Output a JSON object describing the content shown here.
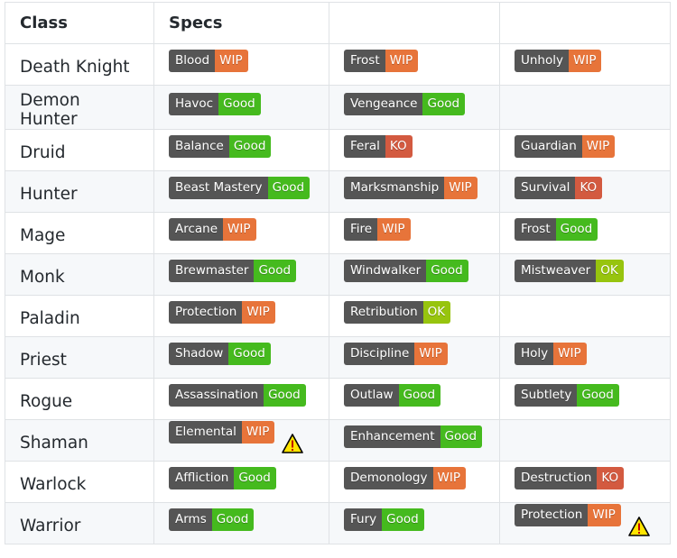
{
  "headers": [
    "Class",
    "Specs",
    "",
    ""
  ],
  "status_colors": {
    "WIP": "#e7743a",
    "Good": "#45ba1e",
    "KO": "#d35a40",
    "OK": "#97c40e",
    "label": "#555555"
  },
  "rows": [
    {
      "class": "Death Knight",
      "specs": [
        {
          "name": "Blood",
          "status": "WIP"
        },
        {
          "name": "Frost",
          "status": "WIP"
        },
        {
          "name": "Unholy",
          "status": "WIP"
        }
      ]
    },
    {
      "class": "Demon Hunter",
      "specs": [
        {
          "name": "Havoc",
          "status": "Good"
        },
        {
          "name": "Vengeance",
          "status": "Good"
        }
      ]
    },
    {
      "class": "Druid",
      "specs": [
        {
          "name": "Balance",
          "status": "Good"
        },
        {
          "name": "Feral",
          "status": "KO"
        },
        {
          "name": "Guardian",
          "status": "WIP"
        }
      ]
    },
    {
      "class": "Hunter",
      "specs": [
        {
          "name": "Beast Mastery",
          "status": "Good"
        },
        {
          "name": "Marksmanship",
          "status": "WIP"
        },
        {
          "name": "Survival",
          "status": "KO"
        }
      ]
    },
    {
      "class": "Mage",
      "specs": [
        {
          "name": "Arcane",
          "status": "WIP"
        },
        {
          "name": "Fire",
          "status": "WIP"
        },
        {
          "name": "Frost",
          "status": "Good"
        }
      ]
    },
    {
      "class": "Monk",
      "specs": [
        {
          "name": "Brewmaster",
          "status": "Good"
        },
        {
          "name": "Windwalker",
          "status": "Good"
        },
        {
          "name": "Mistweaver",
          "status": "OK"
        }
      ]
    },
    {
      "class": "Paladin",
      "specs": [
        {
          "name": "Protection",
          "status": "WIP"
        },
        {
          "name": "Retribution",
          "status": "OK"
        }
      ]
    },
    {
      "class": "Priest",
      "specs": [
        {
          "name": "Shadow",
          "status": "Good"
        },
        {
          "name": "Discipline",
          "status": "WIP"
        },
        {
          "name": "Holy",
          "status": "WIP"
        }
      ]
    },
    {
      "class": "Rogue",
      "specs": [
        {
          "name": "Assassination",
          "status": "Good"
        },
        {
          "name": "Outlaw",
          "status": "Good"
        },
        {
          "name": "Subtlety",
          "status": "Good"
        }
      ]
    },
    {
      "class": "Shaman",
      "specs": [
        {
          "name": "Elemental",
          "status": "WIP",
          "warning": true
        },
        {
          "name": "Enhancement",
          "status": "Good"
        }
      ]
    },
    {
      "class": "Warlock",
      "specs": [
        {
          "name": "Affliction",
          "status": "Good"
        },
        {
          "name": "Demonology",
          "status": "WIP"
        },
        {
          "name": "Destruction",
          "status": "KO"
        }
      ]
    },
    {
      "class": "Warrior",
      "specs": [
        {
          "name": "Arms",
          "status": "Good"
        },
        {
          "name": "Fury",
          "status": "Good"
        },
        {
          "name": "Protection",
          "status": "WIP",
          "warning": true
        }
      ]
    }
  ]
}
